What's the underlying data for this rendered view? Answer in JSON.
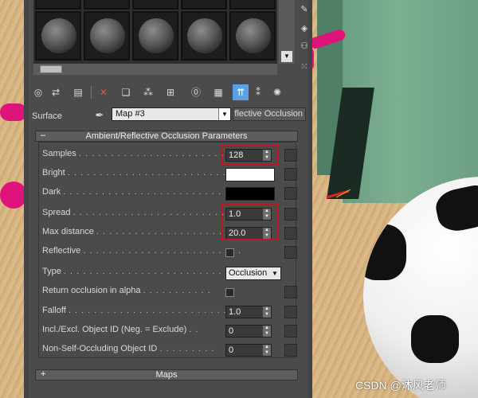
{
  "surface_label": "Surface",
  "map_name": "Map #3",
  "map_type": "flective Occlusion",
  "rollout_title": "Ambient/Reflective Occlusion Parameters",
  "rollout_sign": "–",
  "maps_title": "Maps",
  "maps_sign": "+",
  "params": {
    "samples": {
      "label": "Samples",
      "value": "128"
    },
    "bright": {
      "label": "Bright"
    },
    "dark": {
      "label": "Dark"
    },
    "spread": {
      "label": "Spread",
      "value": "1.0"
    },
    "max_distance": {
      "label": "Max distance",
      "value": "20.0"
    },
    "reflective": {
      "label": "Reflective"
    },
    "type": {
      "label": "Type",
      "value": "Occlusion"
    },
    "return_alpha": {
      "label": "Return occlusion in alpha"
    },
    "falloff": {
      "label": "Falloff",
      "value": "1.0"
    },
    "incl_excl": {
      "label": "Incl./Excl. Object ID (Neg. = Exclude)",
      "value": "0"
    },
    "non_self": {
      "label": "Non-Self-Occluding Object ID",
      "value": "0"
    }
  },
  "watermark": "CSDN @沐风老师",
  "colors": {
    "bright": "#ffffff",
    "dark": "#000000",
    "highlight": "#c0161f",
    "active_tool": "#5aa0e6"
  }
}
